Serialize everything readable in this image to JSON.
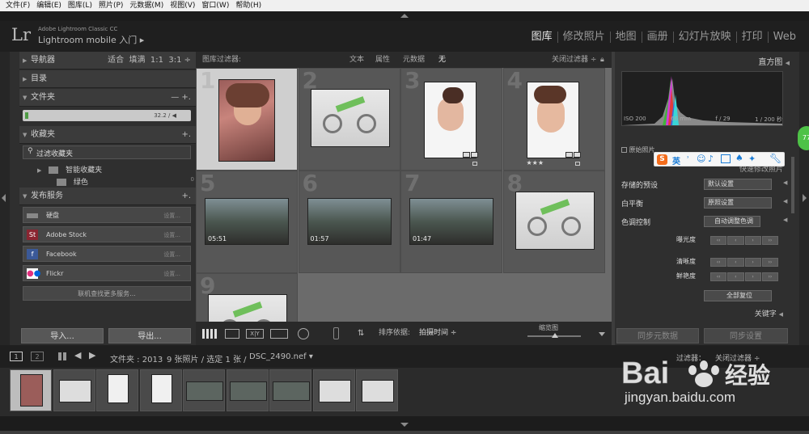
{
  "menubar": [
    "文件(F)",
    "编辑(E)",
    "图库(L)",
    "照片(P)",
    "元数据(M)",
    "视图(V)",
    "窗口(W)",
    "帮助(H)"
  ],
  "identity": {
    "logo": "Lr",
    "product": "Adobe Lightroom Classic CC",
    "mobile": "Lightroom mobile 入门 ▸"
  },
  "modules": [
    {
      "label": "图库",
      "active": true
    },
    {
      "label": "修改照片",
      "active": false
    },
    {
      "label": "地图",
      "active": false
    },
    {
      "label": "画册",
      "active": false
    },
    {
      "label": "幻灯片放映",
      "active": false
    },
    {
      "label": "打印",
      "active": false
    },
    {
      "label": "Web",
      "active": false
    }
  ],
  "left": {
    "navigator": {
      "label": "导航器",
      "opts": [
        "适合",
        "填满",
        "1:1",
        "3:1"
      ]
    },
    "catalog": {
      "label": "目录"
    },
    "folders": {
      "label": "文件夹",
      "ops": "— +.",
      "bar_value": "32.2 / ◀"
    },
    "collections": {
      "label": "收藏夹",
      "filter": "过滤收藏夹",
      "smart": "智能收藏夹",
      "green": "绿色",
      "green_count": "0"
    },
    "publish": {
      "label": "发布服务",
      "services": [
        {
          "name": "硬盘",
          "setting": "设置..."
        },
        {
          "name": "Adobe Stock",
          "setting": "设置..."
        },
        {
          "name": "Facebook",
          "setting": "设置..."
        },
        {
          "name": "Flickr",
          "setting": "设置..."
        }
      ],
      "more": "联机查找更多服务..."
    },
    "import": "导入...",
    "export": "导出..."
  },
  "filter": {
    "title": "图库过滤器:",
    "opts": [
      "文本",
      "属性",
      "元数据",
      "无"
    ],
    "close": "关闭过滤器 ÷"
  },
  "grid": [
    {
      "n": "1",
      "kind": "portrait",
      "selected": true
    },
    {
      "n": "2",
      "kind": "bike"
    },
    {
      "n": "3",
      "kind": "face"
    },
    {
      "n": "4",
      "kind": "face2",
      "stars": "★★★"
    },
    {
      "n": "5",
      "kind": "video",
      "duration": "05:51"
    },
    {
      "n": "6",
      "kind": "video",
      "duration": "01:57"
    },
    {
      "n": "7",
      "kind": "video",
      "duration": "01:47"
    },
    {
      "n": "8",
      "kind": "bike"
    },
    {
      "n": "9",
      "kind": "bike"
    }
  ],
  "toolbar": {
    "sort_label": "排序依据:",
    "sort_value": "拍摄时间 ÷",
    "thumb_label": "缩览图"
  },
  "right": {
    "histogram_label": "直方图",
    "exif": [
      "ISO 200",
      "66 mm",
      "f / 29",
      "1 / 200 秒"
    ],
    "original": "原始照片",
    "quick_develop": "快速修改照片",
    "preset_label": "存储的预设",
    "preset_value": "默认设置",
    "wb_label": "白平衡",
    "wb_value": "原照设置",
    "tone_label": "色调控制",
    "tone_value": "自动调整色调",
    "exposure": "曝光度",
    "clarity": "清晰度",
    "vibrance": "鲜艳度",
    "reset": "全部复位",
    "keywords": "关键字",
    "sync_meta": "同步元数据",
    "sync_settings": "同步设置"
  },
  "filmbar": {
    "pages": [
      "1",
      "2"
    ],
    "path": "文件夹 : 2013",
    "count": "9 张照片 / 选定 1 张 /",
    "file": "DSC_2490.nef ▾",
    "filter": "过滤器：",
    "filter_value": "关闭过滤器 ÷"
  },
  "ime": {
    "label": "英"
  },
  "bubble": "77",
  "watermark": {
    "brand": "Bai 经验",
    "url": "jingyan.baidu.com"
  }
}
